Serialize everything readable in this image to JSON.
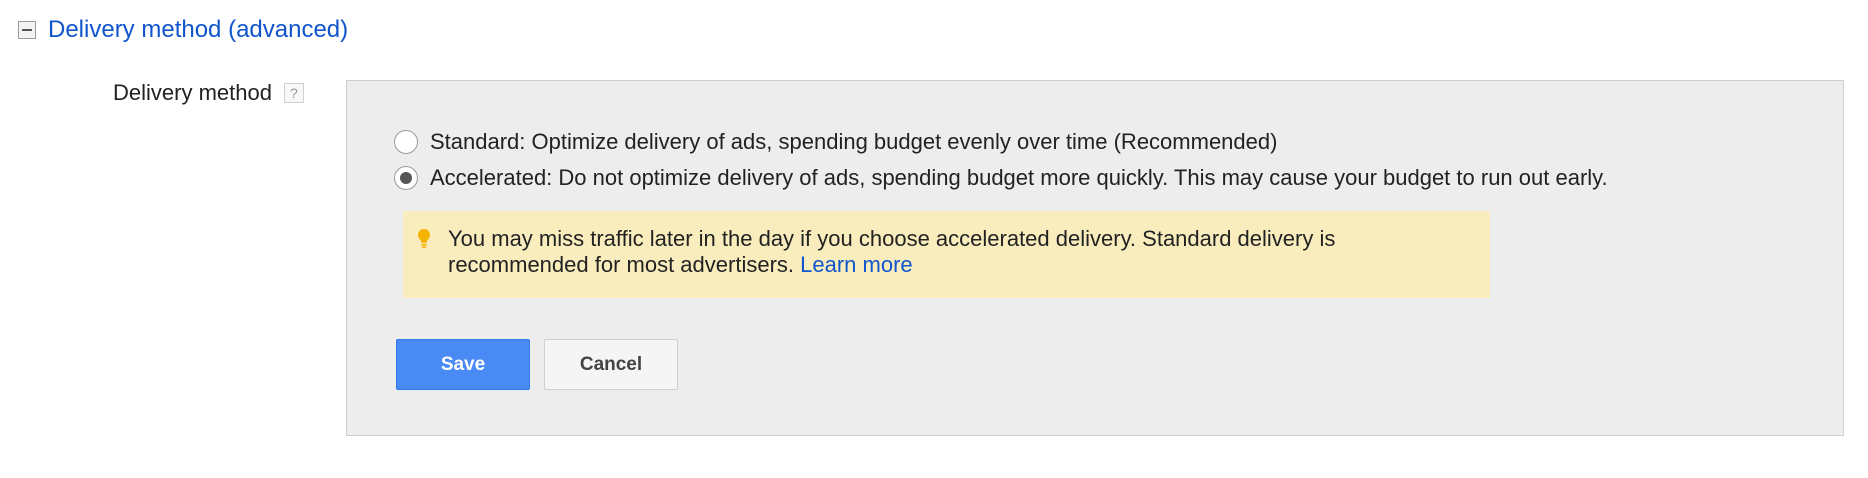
{
  "section": {
    "title": "Delivery method (advanced)",
    "collapse_icon": "collapse-minus-icon"
  },
  "field": {
    "label": "Delivery method",
    "help_icon_text": "?"
  },
  "options": {
    "standard": {
      "label": "Standard: Optimize delivery of ads, spending budget evenly over time (Recommended)",
      "selected": false
    },
    "accelerated": {
      "label": "Accelerated: Do not optimize delivery of ads, spending budget more quickly. This may cause your budget to run out early.",
      "selected": true
    }
  },
  "notice": {
    "icon": "lightbulb-icon",
    "text": "You may miss traffic later in the day if you choose accelerated delivery. Standard delivery is recommended for most advertisers. ",
    "link_text": "Learn more",
    "background_color": "#f9edbe",
    "icon_color": "#f4b400"
  },
  "actions": {
    "save_label": "Save",
    "cancel_label": "Cancel",
    "save_color": "#4a8af4"
  },
  "colors": {
    "link": "#1155cc",
    "panel_background": "#ededed"
  }
}
